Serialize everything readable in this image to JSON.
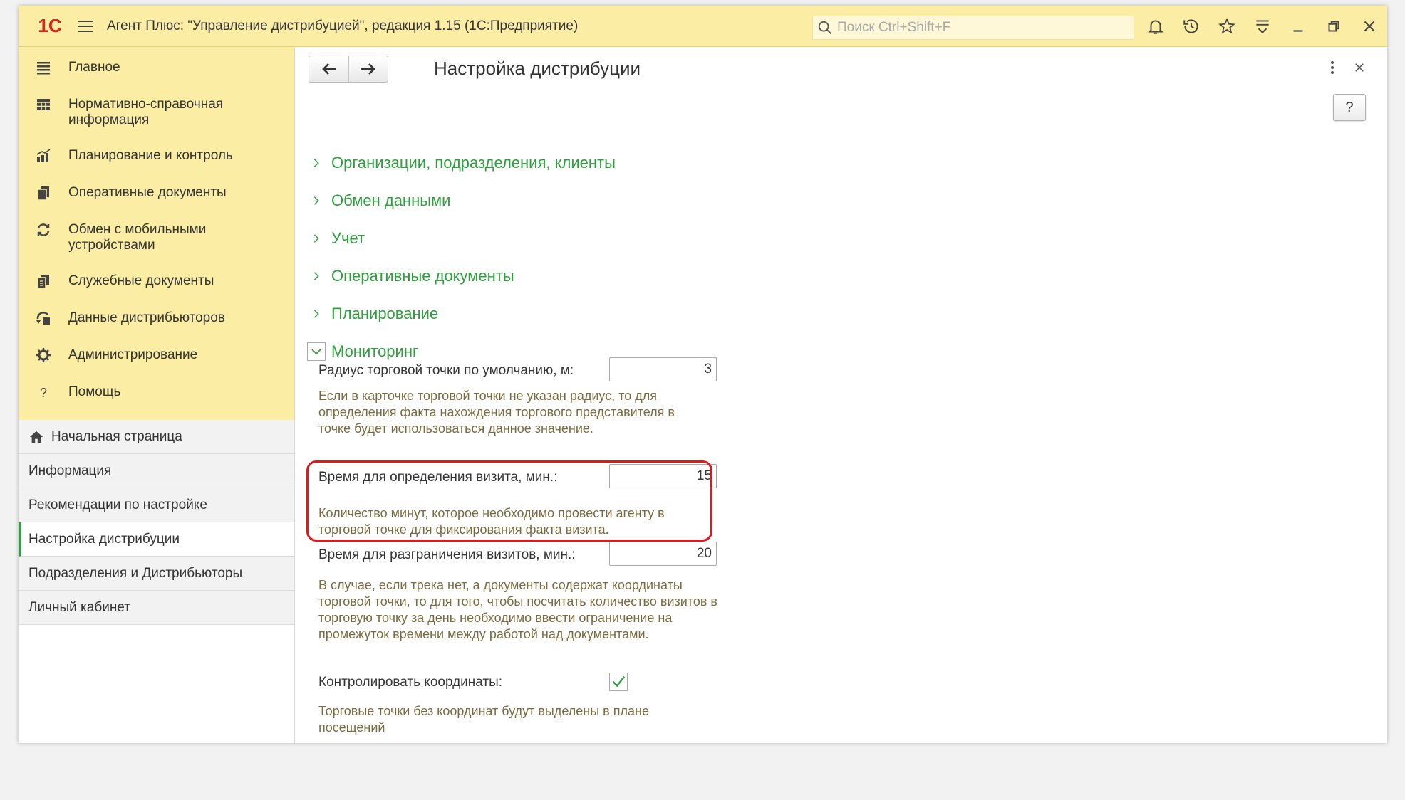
{
  "titlebar": {
    "logo": "1С",
    "title": "Агент Плюс: \"Управление дистрибуцией\", редакция 1.15  (1С:Предприятие)",
    "search_placeholder": "Поиск Ctrl+Shift+F"
  },
  "sidebar": {
    "sections": [
      {
        "label": "Главное",
        "icon": "menu-lines-icon"
      },
      {
        "label": "Нормативно-справочная информация",
        "icon": "table-grid-icon"
      },
      {
        "label": "Планирование и контроль",
        "icon": "bar-chart-icon"
      },
      {
        "label": "Оперативные документы",
        "icon": "documents-icon"
      },
      {
        "label": "Обмен с мобильными устройствами",
        "icon": "sync-icon"
      },
      {
        "label": "Служебные документы",
        "icon": "service-documents-icon"
      },
      {
        "label": "Данные дистрибьюторов",
        "icon": "distributor-data-icon"
      },
      {
        "label": "Администрирование",
        "icon": "gear-icon"
      },
      {
        "label": "Помощь",
        "icon": "question-icon"
      }
    ],
    "nav": [
      {
        "label": "Начальная страница"
      },
      {
        "label": "Информация"
      },
      {
        "label": "Рекомендации по настройке"
      },
      {
        "label": "Настройка дистрибуции"
      },
      {
        "label": "Подразделения и Дистрибьюторы"
      },
      {
        "label": "Личный кабинет"
      }
    ]
  },
  "main": {
    "title": "Настройка дистрибуции",
    "help_label": "?",
    "groups": [
      {
        "label": "Организации, подразделения, клиенты"
      },
      {
        "label": "Обмен данными"
      },
      {
        "label": "Учет"
      },
      {
        "label": "Оперативные документы"
      },
      {
        "label": "Планирование"
      },
      {
        "label": "Мониторинг"
      }
    ],
    "monitoring": {
      "radius_label": "Радиус торговой точки по умолчанию, м:",
      "radius_value": "3",
      "radius_hint": "Если в карточке торговой точки не указан радиус, то для определения факта нахождения торгового представителя в точке будет использоваться данное значение.",
      "visit_time_label": "Время для определения визита, мин.:",
      "visit_time_value": "15",
      "visit_time_hint": "Количество минут, которое необходимо провести агенту в торговой точке для фиксирования факта визита.",
      "visit_split_label": "Время для разграничения визитов, мин.:",
      "visit_split_value": "20",
      "visit_split_hint": "В случае, если трека нет, а документы содержат координаты торговой точки, то для того, чтобы посчитать количество визитов в торговую точку за день необходимо ввести ограничение на промежуток времени между работой над документами.",
      "control_coords_label": "Контролировать координаты:",
      "control_coords_checked": true,
      "control_coords_hint": "Торговые точки без координат будут выделены в плане посещений"
    }
  },
  "colors": {
    "accent_green": "#2e9f3d",
    "title_bar": "#fbeda4",
    "highlight_red": "#e0191d",
    "hint_text": "#7a6a3f"
  }
}
